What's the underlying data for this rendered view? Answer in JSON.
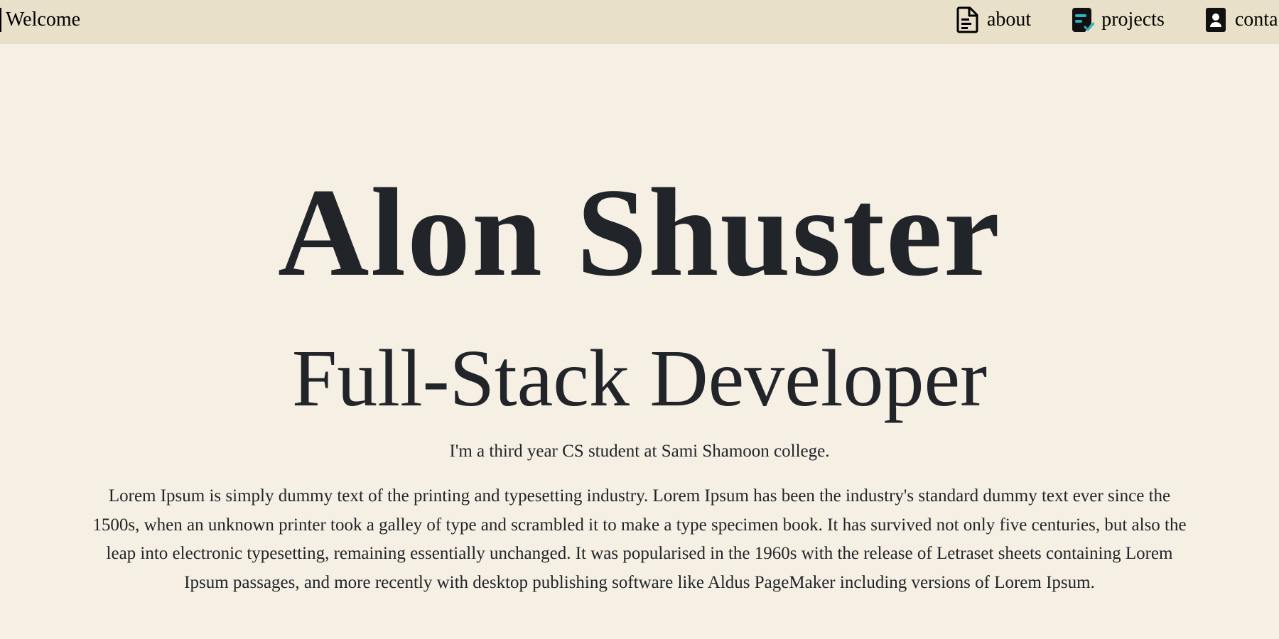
{
  "nav": {
    "brand": "Welcome",
    "links": [
      {
        "label": "about",
        "icon": "document-icon"
      },
      {
        "label": "projects",
        "icon": "checklist-document-icon"
      },
      {
        "label": "conta",
        "icon": "contact-card-icon"
      }
    ]
  },
  "hero": {
    "name": "Alon Shuster",
    "role": "Full-Stack Developer",
    "tagline": "I'm a third year CS student at Sami Shamoon college.",
    "body": "Lorem Ipsum is simply dummy text of the printing and typesetting industry. Lorem Ipsum has been the industry's standard dummy text ever since the 1500s, when an unknown printer took a galley of type and scrambled it to make a type specimen book. It has survived not only five centuries, but also the leap into electronic typesetting, remaining essentially unchanged. It was popularised in the 1960s with the release of Letraset sheets containing Lorem Ipsum passages, and more recently with desktop publishing software like Aldus PageMaker including versions of Lorem Ipsum."
  },
  "colors": {
    "page_background": "#f6efe4",
    "navbar_background": "#e8e0c8",
    "text": "#212529",
    "accent": "#2bb3c0"
  }
}
